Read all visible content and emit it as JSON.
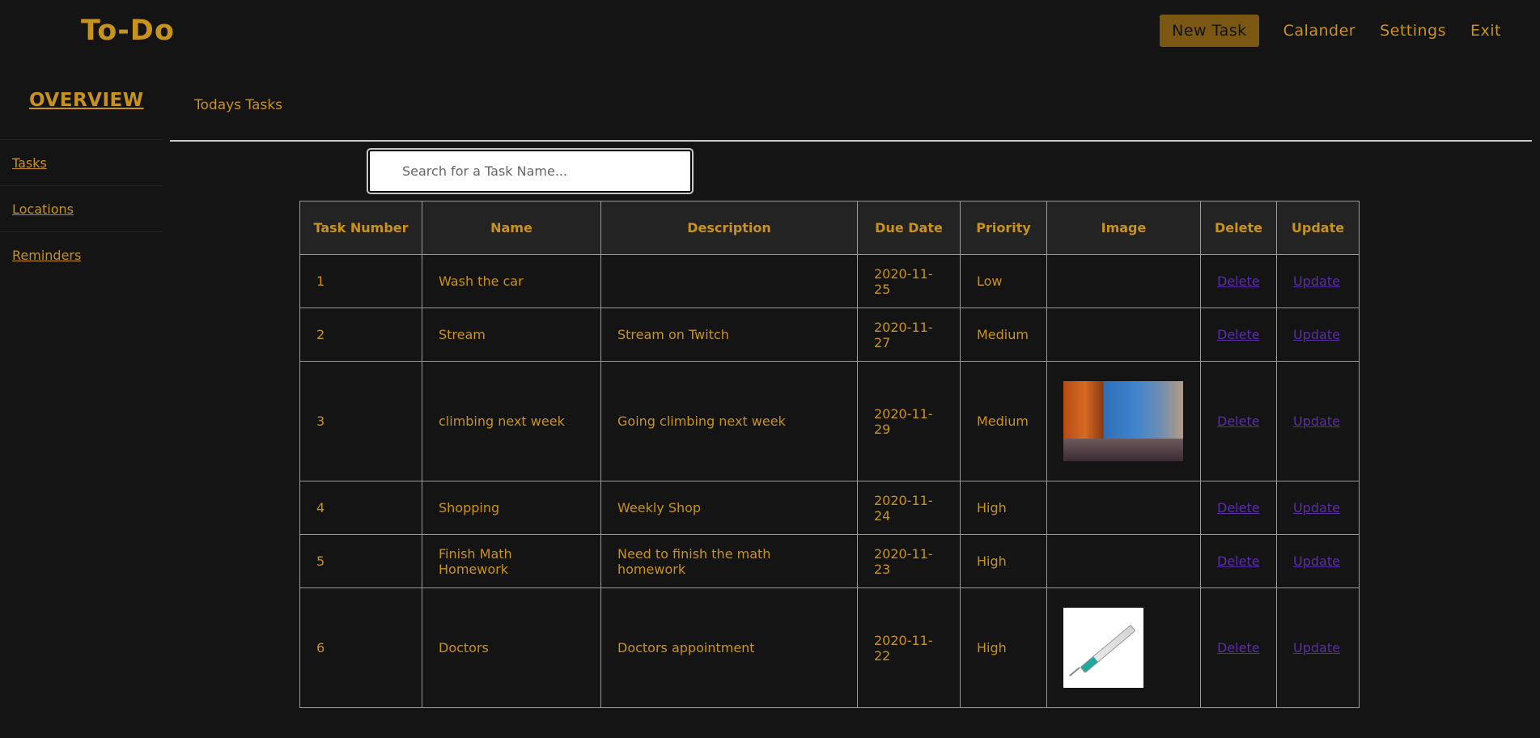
{
  "app": {
    "title": "To-Do"
  },
  "topnav": {
    "new_task": "New Task",
    "calendar": "Calander",
    "settings": "Settings",
    "exit": "Exit"
  },
  "sidebar": {
    "overview": "OVERVIEW",
    "items": [
      {
        "label": "Tasks"
      },
      {
        "label": "Locations"
      },
      {
        "label": "Reminders"
      }
    ]
  },
  "main": {
    "section_title": "Todays Tasks",
    "search_placeholder": "Search for a Task Name..."
  },
  "table": {
    "headers": [
      "Task Number",
      "Name",
      "Description",
      "Due Date",
      "Priority",
      "Image",
      "Delete",
      "Update"
    ],
    "rows": [
      {
        "num": "1",
        "name": "Wash the car",
        "description": "",
        "due": "2020-11-25",
        "priority": "Low",
        "image": "",
        "delete": "Delete",
        "update": "Update"
      },
      {
        "num": "2",
        "name": "Stream",
        "description": "Stream on Twitch",
        "due": "2020-11-27",
        "priority": "Medium",
        "image": "",
        "delete": "Delete",
        "update": "Update"
      },
      {
        "num": "3",
        "name": "climbing next week",
        "description": "Going climbing next week",
        "due": "2020-11-29",
        "priority": "Medium",
        "image": "climbing-photo",
        "delete": "Delete",
        "update": "Update"
      },
      {
        "num": "4",
        "name": "Shopping",
        "description": "Weekly Shop",
        "due": "2020-11-24",
        "priority": "High",
        "image": "",
        "delete": "Delete",
        "update": "Update"
      },
      {
        "num": "5",
        "name": "Finish Math Homework",
        "description": "Need to finish the math homework",
        "due": "2020-11-23",
        "priority": "High",
        "image": "",
        "delete": "Delete",
        "update": "Update"
      },
      {
        "num": "6",
        "name": "Doctors",
        "description": "Doctors appointment",
        "due": "2020-11-22",
        "priority": "High",
        "image": "syringe-photo",
        "delete": "Delete",
        "update": "Update"
      }
    ]
  },
  "colors": {
    "background": "#141414",
    "accent": "#c8921f",
    "button_bg": "#7a5713",
    "link": "#5a2fa3"
  }
}
